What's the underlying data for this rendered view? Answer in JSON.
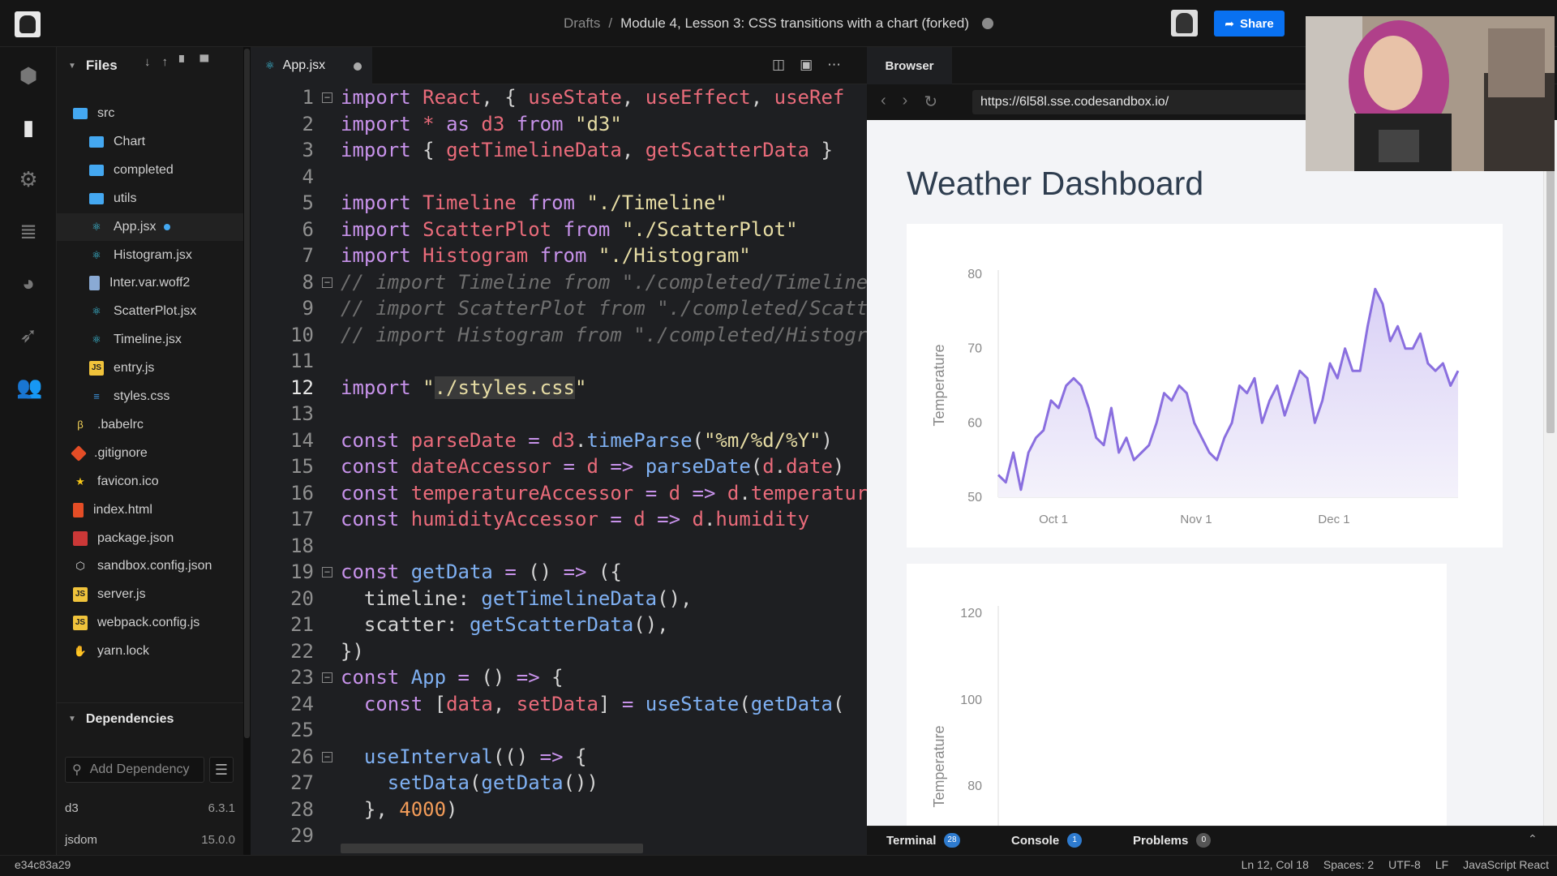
{
  "topbar": {
    "breadcrumb_parent": "Drafts",
    "separator": "/",
    "sandbox_title": "Module 4, Lesson 3: CSS transitions with a chart (forked)",
    "share_label": "Share"
  },
  "sidebar": {
    "files_label": "Files",
    "items": [
      {
        "name": "src",
        "icon": "folder"
      },
      {
        "name": "Chart",
        "icon": "folder"
      },
      {
        "name": "completed",
        "icon": "folder"
      },
      {
        "name": "utils",
        "icon": "folder"
      },
      {
        "name": "App.jsx",
        "icon": "react"
      },
      {
        "name": "Histogram.jsx",
        "icon": "react"
      },
      {
        "name": "Inter.var.woff2",
        "icon": "file"
      },
      {
        "name": "ScatterPlot.jsx",
        "icon": "react"
      },
      {
        "name": "Timeline.jsx",
        "icon": "react"
      },
      {
        "name": "entry.js",
        "icon": "js"
      },
      {
        "name": "styles.css",
        "icon": "css"
      },
      {
        "name": ".babelrc",
        "icon": "babel"
      },
      {
        "name": ".gitignore",
        "icon": "git"
      },
      {
        "name": "favicon.ico",
        "icon": "star"
      },
      {
        "name": "index.html",
        "icon": "html"
      },
      {
        "name": "package.json",
        "icon": "npm"
      },
      {
        "name": "sandbox.config.json",
        "icon": "box"
      },
      {
        "name": "server.js",
        "icon": "js"
      },
      {
        "name": "webpack.config.js",
        "icon": "js"
      },
      {
        "name": "yarn.lock",
        "icon": "yarn"
      }
    ],
    "dependencies_label": "Dependencies",
    "add_dependency_placeholder": "Add Dependency",
    "dependencies": [
      {
        "name": "d3",
        "version": "6.3.1"
      },
      {
        "name": "jsdom",
        "version": "15.0.0"
      }
    ]
  },
  "editor": {
    "tab_label": "App.jsx",
    "lines": [
      "1",
      "2",
      "3",
      "4",
      "5",
      "6",
      "7",
      "8",
      "9",
      "10",
      "11",
      "12",
      "13",
      "14",
      "15",
      "16",
      "17",
      "18",
      "19",
      "20",
      "21",
      "22",
      "23",
      "24",
      "25",
      "26",
      "27",
      "28",
      "29"
    ],
    "current_line": 12
  },
  "browser": {
    "tab_label": "Browser",
    "url": "https://6l58l.sse.codesandbox.io/",
    "page_title": "Weather Dashboard"
  },
  "chart_data": [
    {
      "type": "area",
      "title": "",
      "ylabel": "Temperature",
      "xlabel": "",
      "ylim": [
        50,
        80
      ],
      "y_ticks": [
        50,
        60,
        70,
        80
      ],
      "x_ticks": [
        "Oct 1",
        "Nov 1",
        "Dec 1"
      ],
      "series": [
        {
          "values": [
            53,
            52,
            56,
            51,
            56,
            58,
            59,
            63,
            62,
            65,
            66,
            65,
            62,
            58,
            57,
            62,
            56,
            58,
            55,
            56,
            57,
            60,
            64,
            63,
            65,
            64,
            60,
            58,
            56,
            55,
            58,
            60,
            65,
            64,
            66,
            60,
            63,
            65,
            61,
            64,
            67,
            66,
            60,
            63,
            68,
            66,
            70,
            67,
            67,
            73,
            78,
            76,
            71,
            73,
            70,
            70,
            72,
            68,
            67,
            68,
            65,
            67
          ]
        }
      ],
      "color": "#8a6fdf"
    },
    {
      "type": "scatter",
      "title": "",
      "ylabel": "Temperature",
      "y_ticks": [
        80,
        100,
        120
      ],
      "color": "#8a6fdf"
    }
  ],
  "bottom_panel": {
    "tabs": [
      {
        "label": "Terminal",
        "badge": "28"
      },
      {
        "label": "Console",
        "badge": "1"
      },
      {
        "label": "Problems",
        "badge": "0"
      }
    ]
  },
  "statusbar": {
    "commit": "e34c83a29",
    "position": "Ln 12, Col 18",
    "spaces": "Spaces: 2",
    "encoding": "UTF-8",
    "eol": "LF",
    "language": "JavaScript React"
  },
  "colors": {
    "accent": "#0971f1",
    "chart": "#8a6fdf",
    "folder": "#44a8f1"
  }
}
